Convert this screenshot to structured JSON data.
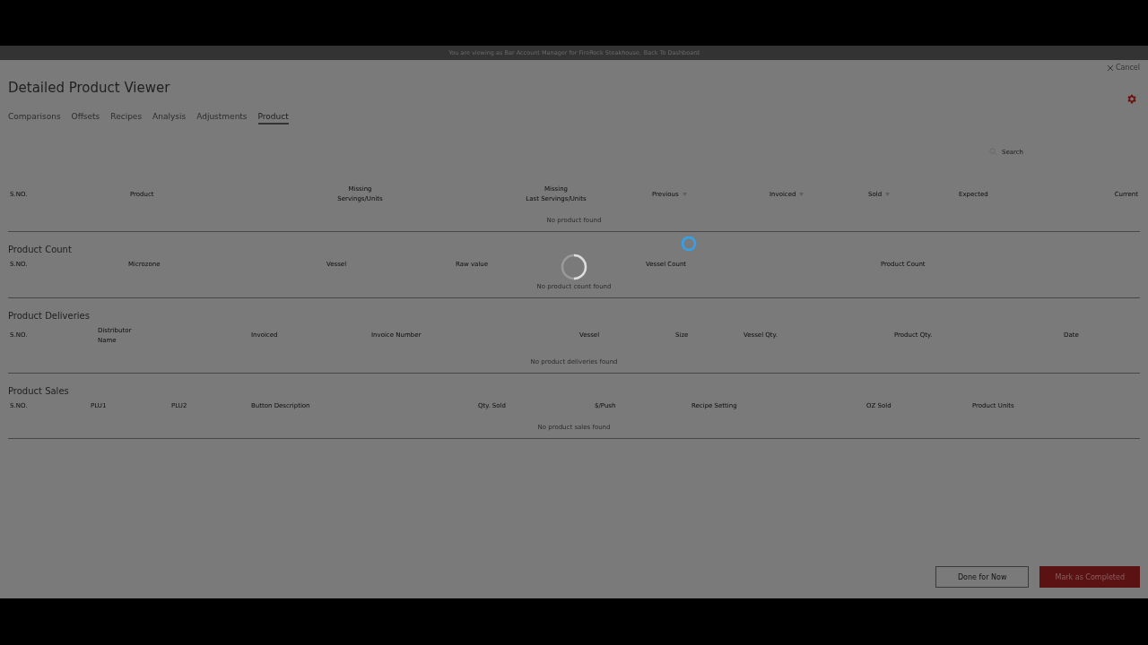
{
  "banner": {
    "text": "You are viewing as Bar Account Manager for FireRock Steakhouse.",
    "link": "Back To Dashboard"
  },
  "cancel": {
    "label": "Cancel"
  },
  "title": "Detailed Product Viewer",
  "tabs": [
    {
      "label": "Comparisons",
      "selected": false
    },
    {
      "label": "Offsets",
      "selected": false
    },
    {
      "label": "Recipes",
      "selected": false
    },
    {
      "label": "Analysis",
      "selected": false
    },
    {
      "label": "Adjustments",
      "selected": false
    },
    {
      "label": "Product",
      "selected": true
    }
  ],
  "search": {
    "placeholder": "Search"
  },
  "tables": [
    {
      "columns": [
        {
          "label": "S.NO.",
          "sort": false
        },
        {
          "label": "Product",
          "sort": false
        },
        {
          "label": "Missing\nServings/Units",
          "sort": false
        },
        {
          "label": "Missing\nLast Servings/Units",
          "sort": false
        },
        {
          "label": "Previous",
          "sort": true
        },
        {
          "label": "Invoiced",
          "sort": true
        },
        {
          "label": "Sold",
          "sort": true
        },
        {
          "label": "Expected",
          "sort": false
        },
        {
          "label": "Current",
          "sort": false
        }
      ],
      "empty": "No product found"
    },
    {
      "title": "Product Count",
      "columns": [
        {
          "label": "S.NO."
        },
        {
          "label": "Microzone"
        },
        {
          "label": "Vessel"
        },
        {
          "label": "Raw value"
        },
        {
          "label": "Vessel Count"
        },
        {
          "label": "Product Count"
        }
      ],
      "empty": "No product count found"
    },
    {
      "title": "Product Deliveries",
      "columns": [
        {
          "label": "S.NO."
        },
        {
          "label": "Distributor\nName"
        },
        {
          "label": "Invoiced"
        },
        {
          "label": "Invoice Number"
        },
        {
          "label": "Vessel"
        },
        {
          "label": "Size"
        },
        {
          "label": "Vessel Qty."
        },
        {
          "label": "Product Qty."
        },
        {
          "label": "Date"
        }
      ],
      "empty": "No product deliveries found"
    },
    {
      "title": "Product Sales",
      "columns": [
        {
          "label": "S.NO."
        },
        {
          "label": "PLU1"
        },
        {
          "label": "PLU2"
        },
        {
          "label": "Button Description"
        },
        {
          "label": "Qty. Sold"
        },
        {
          "label": "$/Push"
        },
        {
          "label": "Recipe Setting"
        },
        {
          "label": "OZ Sold"
        },
        {
          "label": "Product Units"
        }
      ],
      "empty": "No product sales found"
    }
  ],
  "buttons": [
    {
      "label": "Done for Now",
      "kind": "outline"
    },
    {
      "label": "Mark as Completed",
      "kind": "primary"
    }
  ]
}
